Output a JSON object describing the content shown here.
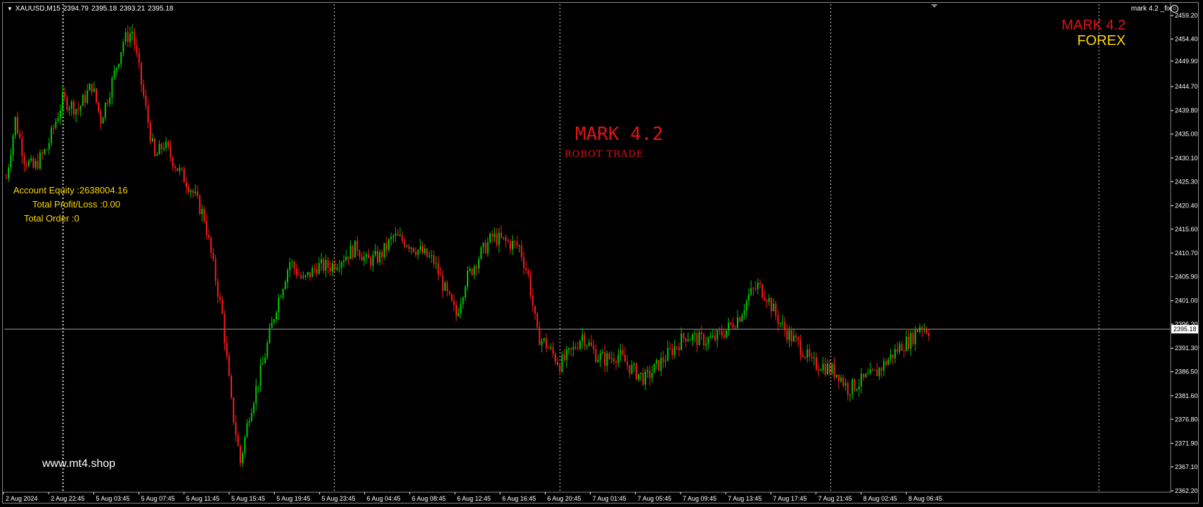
{
  "window": {
    "symbol": "XAUUSD,M15",
    "ohlc": [
      "2394.79",
      "2395.18",
      "2393.21",
      "2395.18"
    ],
    "ea_name": "mark 4.2 _fix",
    "ea_icon": "smile-icon"
  },
  "overlay": {
    "corner_title": "MARK 4.2",
    "corner_subtitle": "FOREX",
    "center_title": "MARK 4.2",
    "center_subtitle": "ROBOT TRADE",
    "account_equity": "Account Equity :2638004.16",
    "total_profit_loss": "Total Profit/Loss :0.00",
    "total_order": "Total Order :0",
    "site_url": "www.mt4.shop"
  },
  "colors": {
    "bull": "#00c800",
    "bear": "#ff1a1a",
    "grid": "#d0d0d0",
    "text": "#ffffff",
    "accent_red": "#e01515",
    "accent_yellow": "#ffd800"
  },
  "chart_data": {
    "type": "candlestick",
    "symbol": "XAUUSD",
    "timeframe": "M15",
    "y_ticks": [
      "2459.20",
      "2454.40",
      "2449.90",
      "2444.70",
      "2439.80",
      "2435.00",
      "2430.10",
      "2425.30",
      "2420.40",
      "2415.60",
      "2410.70",
      "2405.90",
      "2401.00",
      "2396.20",
      "2391.30",
      "2386.50",
      "2381.60",
      "2376.80",
      "2371.90",
      "2367.10",
      "2362.20"
    ],
    "current_price": "2395.18",
    "x_ticks": [
      "2 Aug 2024",
      "2 Aug 22:45",
      "5 Aug 03:45",
      "5 Aug 07:45",
      "5 Aug 11:45",
      "5 Aug 15:45",
      "5 Aug 19:45",
      "5 Aug 23:45",
      "6 Aug 04:45",
      "6 Aug 08:45",
      "6 Aug 12:45",
      "6 Aug 16:45",
      "6 Aug 20:45",
      "7 Aug 01:45",
      "7 Aug 05:45",
      "7 Aug 09:45",
      "7 Aug 13:45",
      "7 Aug 17:45",
      "7 Aug 21:45",
      "8 Aug 02:45",
      "8 Aug 06:45"
    ],
    "period_separators": [
      "2 Aug 22:45",
      "5 Aug 23:45",
      "6 Aug 20:45",
      "7 Aug 21:45"
    ],
    "ylim": [
      2362.2,
      2461.5
    ],
    "price_path": [
      [
        0,
        2426
      ],
      [
        4,
        2438
      ],
      [
        8,
        2430
      ],
      [
        12,
        2428
      ],
      [
        18,
        2432
      ],
      [
        25,
        2442
      ],
      [
        32,
        2440
      ],
      [
        38,
        2445
      ],
      [
        42,
        2438
      ],
      [
        46,
        2444
      ],
      [
        52,
        2454
      ],
      [
        56,
        2456
      ],
      [
        62,
        2440
      ],
      [
        66,
        2430
      ],
      [
        70,
        2433
      ],
      [
        76,
        2428
      ],
      [
        82,
        2424
      ],
      [
        88,
        2418
      ],
      [
        92,
        2408
      ],
      [
        96,
        2398
      ],
      [
        100,
        2380
      ],
      [
        104,
        2368
      ],
      [
        108,
        2378
      ],
      [
        114,
        2388
      ],
      [
        120,
        2400
      ],
      [
        126,
        2409
      ],
      [
        132,
        2405
      ],
      [
        138,
        2408
      ],
      [
        144,
        2408
      ],
      [
        150,
        2410
      ],
      [
        156,
        2412
      ],
      [
        160,
        2409
      ],
      [
        166,
        2410
      ],
      [
        172,
        2414
      ],
      [
        178,
        2413
      ],
      [
        184,
        2411
      ],
      [
        190,
        2409
      ],
      [
        196,
        2402
      ],
      [
        200,
        2398
      ],
      [
        204,
        2405
      ],
      [
        210,
        2410
      ],
      [
        216,
        2414
      ],
      [
        222,
        2413
      ],
      [
        228,
        2412
      ],
      [
        232,
        2406
      ],
      [
        236,
        2394
      ],
      [
        240,
        2392
      ],
      [
        246,
        2388
      ],
      [
        252,
        2391
      ],
      [
        256,
        2394
      ],
      [
        262,
        2390
      ],
      [
        266,
        2389
      ],
      [
        272,
        2390
      ],
      [
        278,
        2387
      ],
      [
        284,
        2385
      ],
      [
        290,
        2388
      ],
      [
        296,
        2391
      ],
      [
        302,
        2394
      ],
      [
        308,
        2393
      ],
      [
        314,
        2393
      ],
      [
        320,
        2395
      ],
      [
        326,
        2398
      ],
      [
        330,
        2402
      ],
      [
        334,
        2404
      ],
      [
        338,
        2402
      ],
      [
        342,
        2398
      ],
      [
        346,
        2395
      ],
      [
        350,
        2393
      ],
      [
        354,
        2391
      ],
      [
        358,
        2388
      ],
      [
        362,
        2388
      ],
      [
        366,
        2387
      ],
      [
        370,
        2386
      ],
      [
        374,
        2383
      ],
      [
        378,
        2384
      ],
      [
        382,
        2385
      ],
      [
        386,
        2386
      ],
      [
        390,
        2388
      ],
      [
        394,
        2390
      ],
      [
        398,
        2392
      ],
      [
        402,
        2393
      ],
      [
        406,
        2396
      ],
      [
        410,
        2395
      ]
    ]
  }
}
